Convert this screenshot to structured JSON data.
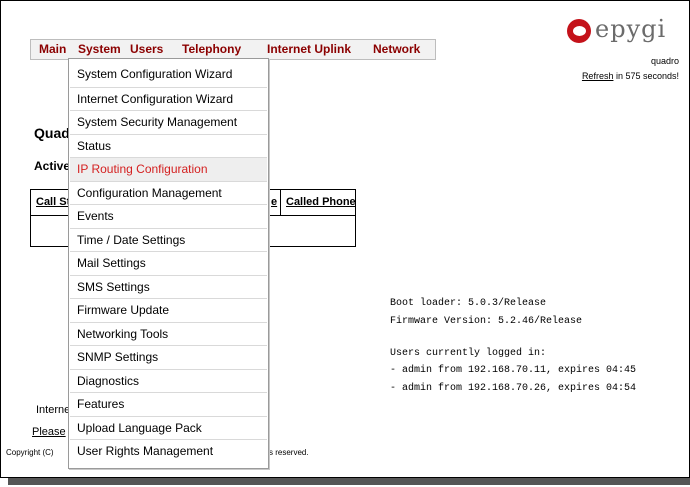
{
  "menubar": {
    "items": [
      "Main",
      "System",
      "Users",
      "Telephony",
      "Internet Uplink",
      "Network"
    ]
  },
  "logo": {
    "text": "epygi",
    "subtext": "quadro"
  },
  "refresh": {
    "link": "Refresh",
    "suffix": " in 575 seconds!"
  },
  "page": {
    "title": "Quad",
    "subtitle": "Active",
    "table_headers": {
      "first": "Call St",
      "middle": "e",
      "last": "Called Phone"
    }
  },
  "system_info": {
    "boot_loader": "Boot loader: 5.0.3/Release",
    "firmware": "Firmware Version: 5.2.46/Release",
    "users_header": "Users currently logged in:",
    "users": [
      "- admin from 192.168.70.11, expires 04:45",
      "- admin from 192.168.70.26, expires 04:54"
    ]
  },
  "footer": {
    "internet": "Interne",
    "please": "Please",
    "copyright": "Copyright (C)",
    "reserved": "s reserved."
  },
  "dropdown": {
    "active_index": 4,
    "items": [
      "System Configuration Wizard",
      "Internet Configuration Wizard",
      "System Security Management",
      "Status",
      "IP Routing Configuration",
      "Configuration Management",
      "Events",
      "Time / Date Settings",
      "Mail Settings",
      "SMS Settings",
      "Firmware Update",
      "Networking Tools",
      "SNMP Settings",
      "Diagnostics",
      "Features",
      "Upload Language Pack",
      "User Rights Management"
    ]
  },
  "colors": {
    "menu_text": "#8b0000",
    "logo_red": "#c4121a",
    "active_item": "#d42020"
  }
}
